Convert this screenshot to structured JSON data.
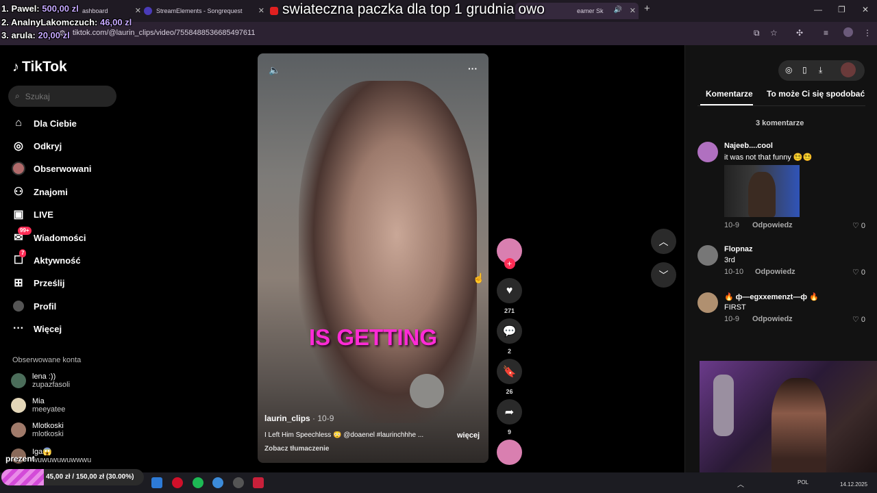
{
  "browser": {
    "tabs": [
      {
        "label": "ashboard"
      },
      {
        "label": "StreamElements - Songrequest"
      },
      {
        "label": ""
      },
      {
        "label": ""
      },
      {
        "label": "eamer Sk"
      }
    ],
    "url": "tiktok.com/@laurin_clips/video/7558488536685497611",
    "new_tab": "+"
  },
  "overlay": {
    "title": "swiateczna paczka dla top 1 grudnia owo",
    "donors": [
      {
        "rank_name": "1. Pawel:",
        "amount": "500,00 zl"
      },
      {
        "rank_name": "2. AnalnyLakomczuch:",
        "amount": "46,00 zl"
      },
      {
        "rank_name": "3. arula:",
        "amount": "20,00 zl"
      }
    ],
    "goal_label": "prezent",
    "goal_text": "45,00 zł / 150,00 zł (30.00%)",
    "goal_fraction": 0.3
  },
  "tiktok": {
    "logo": "TikTok",
    "search_placeholder": "Szukaj",
    "nav": [
      {
        "label": "Dla Ciebie",
        "icon": "home-icon"
      },
      {
        "label": "Odkryj",
        "icon": "compass-icon"
      },
      {
        "label": "Obserwowani",
        "icon": "avatar-icon"
      },
      {
        "label": "Znajomi",
        "icon": "friends-icon"
      },
      {
        "label": "LIVE",
        "icon": "live-icon"
      },
      {
        "label": "Wiadomości",
        "icon": "inbox-icon",
        "badge": "99+"
      },
      {
        "label": "Aktywność",
        "icon": "activity-icon",
        "badge": "7"
      },
      {
        "label": "Prześlij",
        "icon": "upload-icon"
      },
      {
        "label": "Profil",
        "icon": "profile-icon"
      },
      {
        "label": "Więcej",
        "icon": "more-icon"
      }
    ],
    "following_header": "Obserwowane konta",
    "following": [
      {
        "name": "lena :))",
        "handle": "zupazfasoli"
      },
      {
        "name": "Mia",
        "handle": "meeyatee"
      },
      {
        "name": "Mlotkoski",
        "handle": "mlotkoski"
      },
      {
        "name": "Iga😱",
        "handle": "wuwuwuwuwwwu"
      }
    ]
  },
  "video": {
    "caption_overlay": "IS GETTING",
    "author": "laurin_clips",
    "date": "· 10-9",
    "description": "I Left Him Speechless 😳 @doaenel #laurinchhhe ...",
    "more": "więcej",
    "translate": "Zobacz tłumaczenie",
    "likes": "271",
    "comments": "2",
    "saves": "26",
    "shares": "9"
  },
  "comments_panel": {
    "tabs": [
      "Komentarze",
      "To może Ci się spodobać"
    ],
    "count_label": "3 komentarze",
    "comments": [
      {
        "name": "Najeeb....cool",
        "text": "it was not that funny 😵‍💫😵‍💫",
        "date": "10-9",
        "reply": "Odpowiedz",
        "likes": "0"
      },
      {
        "name": "Flopnaz",
        "text": "3rd",
        "date": "10-10",
        "reply": "Odpowiedz",
        "likes": "0"
      },
      {
        "name": "🔥 ф—egxxemenzt—ф 🔥",
        "text": "FIRST",
        "date": "10-9",
        "reply": "Odpowiedz",
        "likes": "0"
      }
    ]
  },
  "taskbar": {
    "lang": "POL",
    "date": "14.12.2025"
  },
  "colors": {
    "accent": "#fe2c55",
    "caption": "#ff2bd6"
  }
}
